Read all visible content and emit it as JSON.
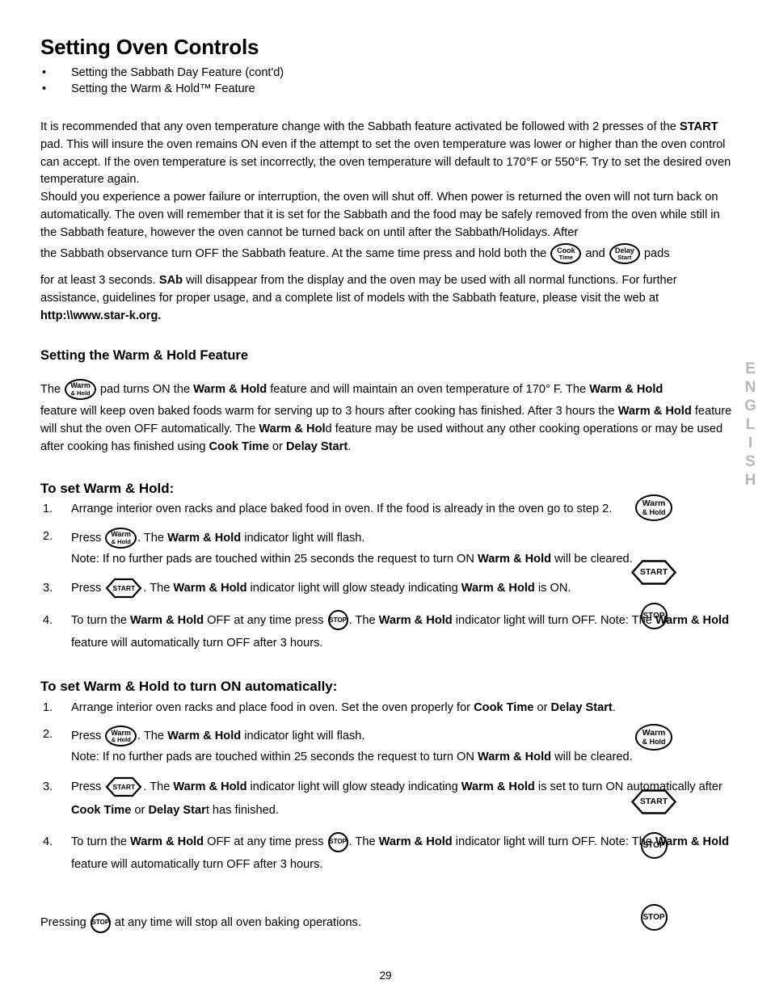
{
  "document": {
    "page_number": "29",
    "side_tab": "ENGLISH"
  },
  "header": {
    "title": "Setting Oven Controls",
    "bullets": [
      "Setting the Sabbath Day Feature (cont'd)",
      "Setting the Warm & Hold™ Feature"
    ],
    "bullet_glyph": "•"
  },
  "pads": {
    "cook_time": {
      "line1": "Cook",
      "line2": "Time"
    },
    "delay_start": {
      "line1": "Delay",
      "line2": "Start"
    },
    "warm_hold": {
      "line1": "Warm",
      "line2": "& Hold"
    },
    "start": {
      "label": "START"
    },
    "stop": {
      "label": "STOP"
    }
  },
  "sabbath_section": {
    "paragraph1": {
      "part1": "It is recommended that any oven temperature change with the Sabbath feature activated be followed with 2 presses of the ",
      "bold1": "START",
      "part2": " pad. This will insure the oven remains ON even if the attempt to set the oven temperature was lower or higher than the oven control can accept. If the oven temperature is set incorrectly, the oven temperature will default to 170°F or 550°F. Try to set the desired oven temperature again."
    },
    "paragraph2": {
      "part1": "Should you experience a power failure or interruption, the oven will shut off. When power is returned the oven will not turn back on automatically. The oven will remember that it is set for the Sabbath and the food may be safely removed from the oven while still in the Sabbath feature, however the oven cannot be turned back on until after the Sabbath/Holidays. After"
    },
    "paragraph3": {
      "part1": "the Sabbath observance turn OFF the Sabbath feature. At the same time press and hold both the ",
      "mid": " and ",
      "part2": " pads"
    },
    "paragraph4": {
      "part1": "for at least 3 seconds. ",
      "bold1": "SAb",
      "part2": " will disappear from the display and the oven may be used with all normal functions. For further assistance, guidelines for proper usage, and a complete list of models with the Sabbath feature, please visit the web at ",
      "bold2": "http:\\\\www.star-k.org."
    }
  },
  "warm_hold_section": {
    "heading": "Setting the Warm & Hold Feature",
    "intro": {
      "part1": "The ",
      "part2": " pad turns ON the ",
      "bold1": "Warm & Hold",
      "part3": " feature and will maintain an oven temperature of 170° F. The ",
      "bold2": "Warm & Hold"
    },
    "body": {
      "part1": " feature will keep oven baked foods warm for serving up to 3 hours after cooking has finished. After 3 hours the ",
      "bold1": "Warm & Hold",
      "part2": " feature will shut the oven OFF automatically. The ",
      "bold2": "Warm & Hol",
      "part3": "d feature may be used without any other cooking operations or may be used after cooking has finished using ",
      "bold3": "Cook Time",
      "part4": " or ",
      "bold4": "Delay Start",
      "part5": "."
    }
  },
  "procedure_1": {
    "heading": "To set Warm & Hold:",
    "steps": [
      {
        "num": "1.",
        "text": "Arrange interior oven racks and place baked food in oven. If the food is already in the oven go to step 2."
      },
      {
        "num": "2.",
        "press_label": "Press ",
        "after_pad": ". The ",
        "bold1": "Warm & Hold",
        "tail": " indicator light will flash.",
        "note": "Note: If no further pads are touched within 25 seconds the request to turn ON ",
        "note_bold": "Warm & Hold",
        "note_tail": " will be cleared."
      },
      {
        "num": "3.",
        "press_label": "Press ",
        "after_pad": ". The ",
        "bold1": "Warm & Hold",
        "mid": " indicator light will glow steady indicating ",
        "bold2": "Warm & Hold",
        "tail": " is ON."
      },
      {
        "num": "4.",
        "lead": "To turn the ",
        "bold1": "Warm & Hold",
        "mid1": " OFF at any time press ",
        "after_pad": ".  The ",
        "bold2": "Warm & Hold",
        "mid2": " indicator light will turn OFF. Note: The ",
        "bold3": "Warm & Hold",
        "tail": " feature will automatically turn OFF after 3 hours."
      }
    ]
  },
  "procedure_2": {
    "heading": "To set Warm & Hold to turn ON automatically:",
    "steps": [
      {
        "num": "1.",
        "text_part1": "Arrange interior oven racks and place food in oven. Set the oven properly for ",
        "bold1": "Cook Time",
        "text_part2": " or ",
        "bold2": "Delay Start",
        "text_part3": "."
      },
      {
        "num": "2.",
        "press_label": "Press ",
        "after_pad": ". The ",
        "bold1": "Warm & Hold",
        "tail": " indicator light will flash.",
        "note": "Note: If no further pads are touched within 25 seconds the request to turn ON ",
        "note_bold": "Warm & Hold",
        "note_tail": " will be cleared."
      },
      {
        "num": "3.",
        "press_label": "Press ",
        "after_pad": ". The ",
        "bold1": "Warm & Hold",
        "mid": " indicator light will glow steady indicating ",
        "bold2": "Warm & Hold",
        "mid2": " is set to turn ON automatically after ",
        "bold3": "Cook Time",
        "mid3": " or ",
        "bold4": "Delay Star",
        "tail": "t has finished."
      },
      {
        "num": "4.",
        "lead": "To turn the ",
        "bold1": "Warm & Hold",
        "mid1": " OFF at any time press ",
        "after_pad": ". The ",
        "bold2": "Warm & Hold",
        "mid2": " indicator light will turn OFF. Note: The ",
        "bold3": "Warm & Hold",
        "tail": " feature will automatically turn OFF after 3 hours."
      }
    ]
  },
  "closing": {
    "part1": "Pressing ",
    "part2": " at any time will stop all oven baking operations."
  }
}
